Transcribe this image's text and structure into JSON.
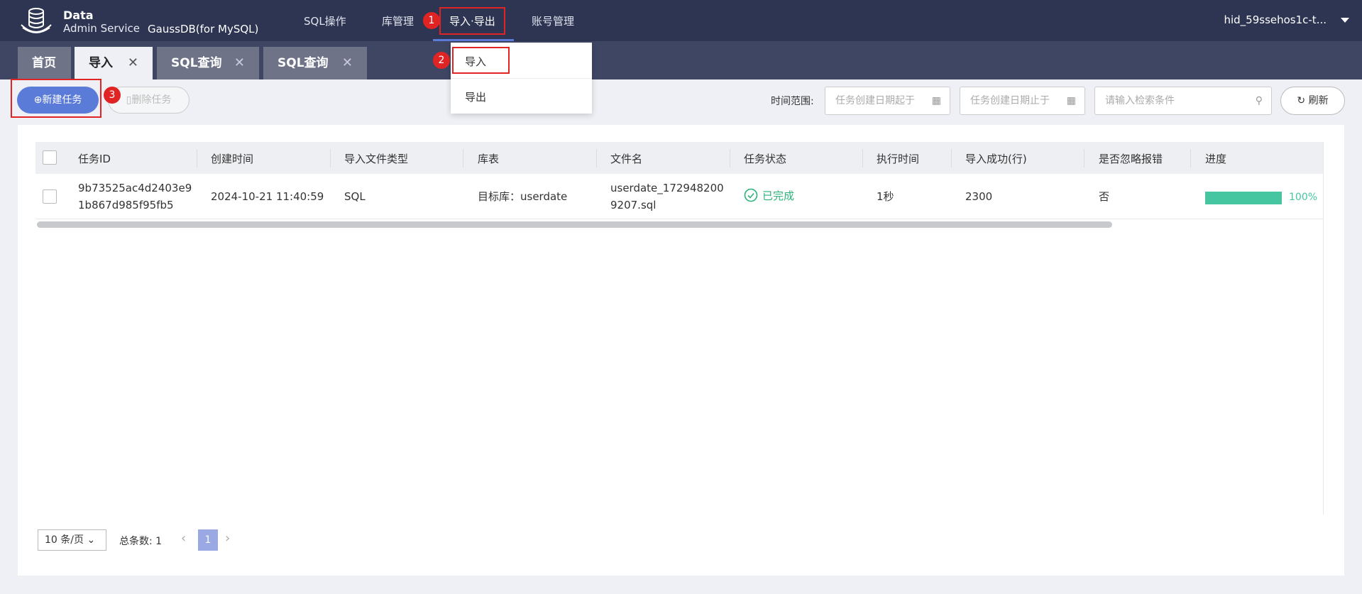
{
  "header": {
    "brand_line1": "Data",
    "brand_line2": "Admin Service",
    "product": "GaussDB(for MySQL)",
    "nav": [
      "SQL操作",
      "库管理",
      "导入·导出",
      "账号管理"
    ],
    "user": "hid_59ssehos1c-t..."
  },
  "tabs": [
    {
      "label": "首页"
    },
    {
      "label": "导入",
      "close": "✕"
    },
    {
      "label": "SQL查询",
      "close": "✕"
    },
    {
      "label": "SQL查询",
      "close": "✕"
    }
  ],
  "dropdown": {
    "items": [
      "导入",
      "导出"
    ]
  },
  "toolbar": {
    "new_task": "⊕新建任务",
    "delete_task": "删除任务",
    "time_range_label": "时间范围:",
    "start_date_placeholder": "任务创建日期起于",
    "end_date_placeholder": "任务创建日期止于",
    "search_placeholder": "请输入检索条件",
    "refresh": "刷新"
  },
  "annotations": [
    "1",
    "2",
    "3"
  ],
  "table": {
    "headers": [
      "任务ID",
      "创建时间",
      "导入文件类型",
      "库表",
      "文件名",
      "任务状态",
      "执行时间",
      "导入成功(行)",
      "是否忽略报错",
      "进度"
    ],
    "rows": [
      {
        "task_id_line1": "9b73525ac4d2403e9",
        "task_id_line2": "1b867d985f95fb5",
        "created": "2024-10-21 11:40:59",
        "file_type": "SQL",
        "db_table": "目标库：userdate",
        "filename_line1": "userdate_172948200",
        "filename_line2": "9207.sql",
        "status": "已完成",
        "exec_time": "1秒",
        "success_rows": "2300",
        "ignore_errors": "否",
        "progress": 1.0,
        "progress_label": "100%"
      }
    ]
  },
  "pagination": {
    "page_size": "10 条/页",
    "total_label": "总条数:",
    "total": "1",
    "current_page": "1"
  },
  "colors": {
    "topbar": "#2e3553",
    "accent": "#5b7bd9",
    "success": "#2bb37a",
    "progress": "#45c6a0",
    "annotation": "#e02424"
  }
}
